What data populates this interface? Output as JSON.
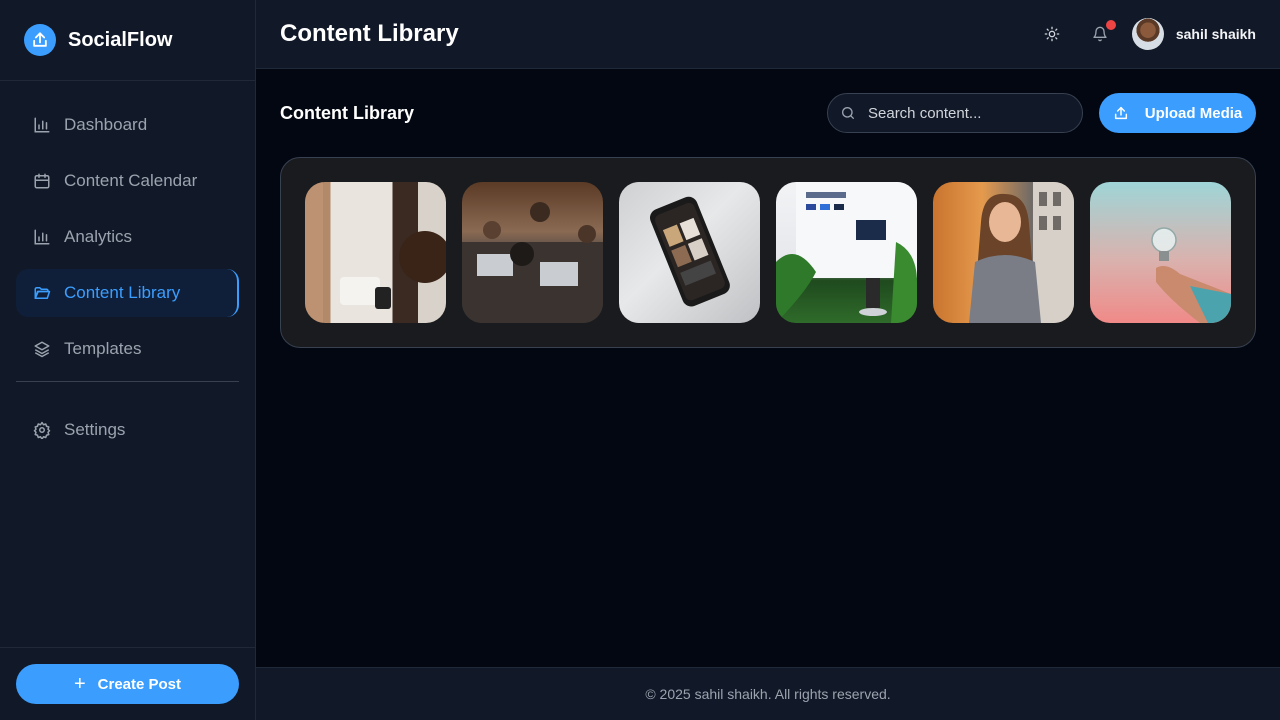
{
  "brand": {
    "name": "SocialFlow"
  },
  "sidebar": {
    "items": [
      {
        "label": "Dashboard",
        "icon": "bar-chart-icon"
      },
      {
        "label": "Content Calendar",
        "icon": "calendar-icon"
      },
      {
        "label": "Analytics",
        "icon": "bar-chart-icon"
      },
      {
        "label": "Content Library",
        "icon": "folder-open-icon",
        "active": true
      },
      {
        "label": "Templates",
        "icon": "layers-icon"
      }
    ],
    "bottom_items": [
      {
        "label": "Settings",
        "icon": "gear-icon"
      }
    ],
    "create_label": "Create Post"
  },
  "header": {
    "title": "Content Library",
    "user_name": "sahil shaikh",
    "has_notification": true
  },
  "main": {
    "section_title": "Content Library",
    "search_placeholder": "Search content...",
    "upload_label": "Upload Media",
    "media": [
      {
        "description": "retail checkout with phone payment"
      },
      {
        "description": "team working on laptops"
      },
      {
        "description": "smartphone on desk"
      },
      {
        "description": "computer monitor with plants"
      },
      {
        "description": "woman smiling against orange wall"
      },
      {
        "description": "hand holding light bulb"
      }
    ]
  },
  "footer": {
    "text": "© 2025 sahil shaikh. All rights reserved."
  },
  "colors": {
    "accent": "#3b9eff",
    "background": "#030712",
    "panel": "#111827",
    "notification": "#ef4444"
  }
}
